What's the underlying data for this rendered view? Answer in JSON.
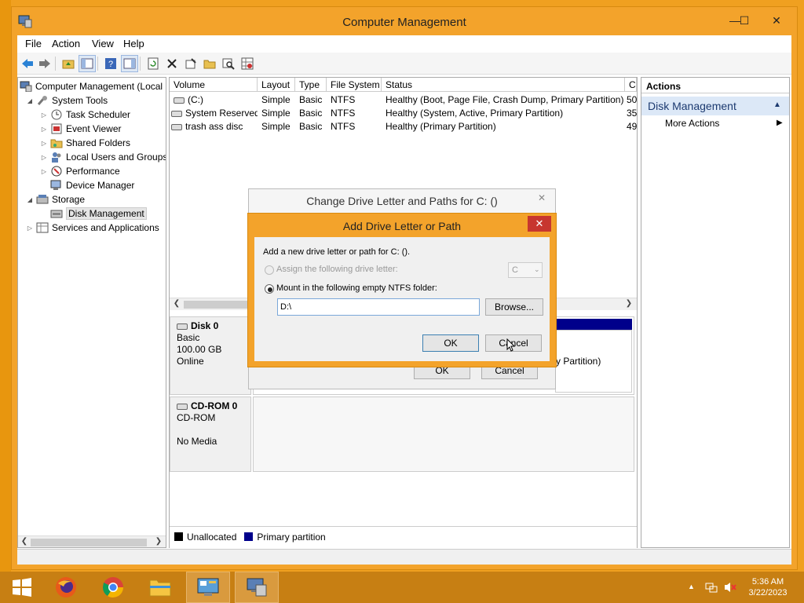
{
  "window": {
    "title": "Computer Management",
    "minimize": "—",
    "maximize": "☐",
    "close": "✕"
  },
  "menu": [
    "File",
    "Action",
    "View",
    "Help"
  ],
  "tree": {
    "root": "Computer Management (Local",
    "system_tools": "System Tools",
    "task_scheduler": "Task Scheduler",
    "event_viewer": "Event Viewer",
    "shared_folders": "Shared Folders",
    "local_users": "Local Users and Groups",
    "performance": "Performance",
    "device_manager": "Device Manager",
    "storage": "Storage",
    "disk_management": "Disk Management",
    "services": "Services and Applications"
  },
  "volume_list": {
    "columns": [
      "Volume",
      "Layout",
      "Type",
      "File System",
      "Status",
      "C"
    ],
    "rows": [
      {
        "volume": "(C:)",
        "layout": "Simple",
        "type": "Basic",
        "fs": "NTFS",
        "status": "Healthy (Boot, Page File, Crash Dump, Primary Partition)",
        "cap": "50"
      },
      {
        "volume": "System Reserved",
        "layout": "Simple",
        "type": "Basic",
        "fs": "NTFS",
        "status": "Healthy (System, Active, Primary Partition)",
        "cap": "35"
      },
      {
        "volume": "trash ass disc",
        "layout": "Simple",
        "type": "Basic",
        "fs": "NTFS",
        "status": "Healthy (Primary Partition)",
        "cap": "49"
      }
    ]
  },
  "disks": {
    "disk0": {
      "name": "Disk 0",
      "type": "Basic",
      "size": "100.00 GB",
      "state": "Online",
      "partition_hint": "y Partition)"
    },
    "cdrom0": {
      "name": "CD-ROM 0",
      "type": "CD-ROM",
      "media": "No Media"
    }
  },
  "legend": {
    "unallocated": "Unallocated",
    "primary": "Primary partition"
  },
  "actions": {
    "header": "Actions",
    "section": "Disk Management",
    "more": "More Actions"
  },
  "dialog_change": {
    "title": "Change Drive Letter and Paths for C: ()",
    "ok": "OK",
    "cancel": "Cancel",
    "close": "✕"
  },
  "dialog_add": {
    "title": "Add Drive Letter or Path",
    "close": "✕",
    "intro": "Add a new drive letter or path for C: ().",
    "assign_label": "Assign the following drive letter:",
    "drive_letter": "C",
    "mount_label": "Mount in the following empty NTFS folder:",
    "path_value": "D:\\",
    "browse": "Browse...",
    "ok": "OK",
    "cancel": "Cancel"
  },
  "tray": {
    "time": "5:36 AM",
    "date": "3/22/2023"
  },
  "colors": {
    "accent": "#f3a32b",
    "primary_partition": "#00008b",
    "unallocated": "#000000",
    "close_red": "#c7362f"
  }
}
